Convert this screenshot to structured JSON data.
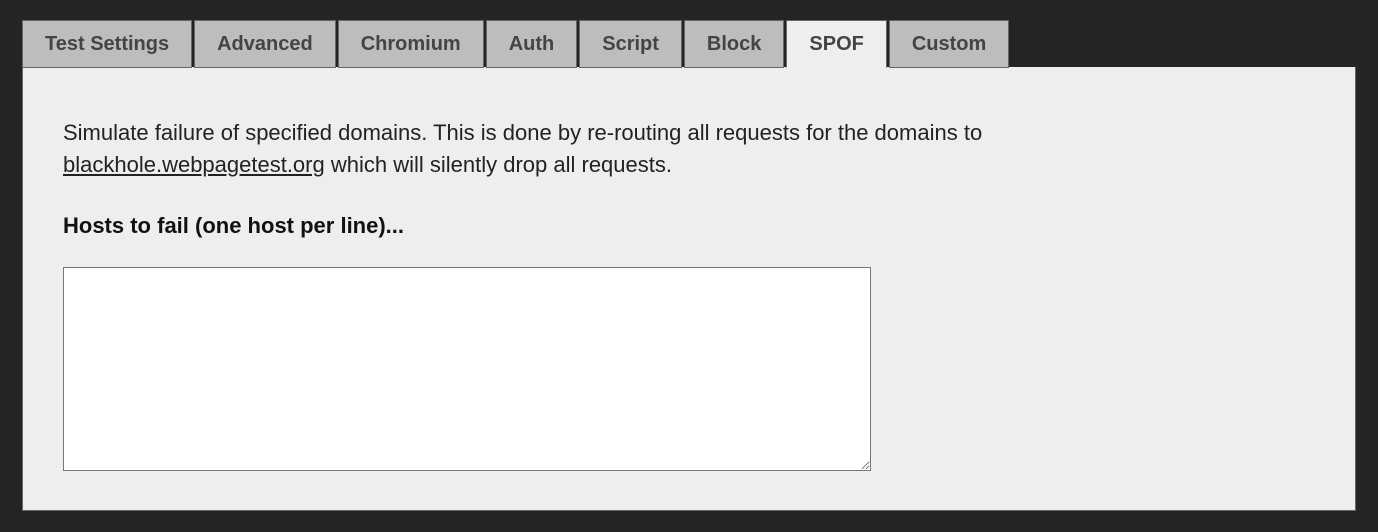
{
  "tabs": [
    {
      "label": "Test Settings",
      "key": "test-settings",
      "active": false
    },
    {
      "label": "Advanced",
      "key": "advanced",
      "active": false
    },
    {
      "label": "Chromium",
      "key": "chromium",
      "active": false
    },
    {
      "label": "Auth",
      "key": "auth",
      "active": false
    },
    {
      "label": "Script",
      "key": "script",
      "active": false
    },
    {
      "label": "Block",
      "key": "block",
      "active": false
    },
    {
      "label": "SPOF",
      "key": "spof",
      "active": true
    },
    {
      "label": "Custom",
      "key": "custom",
      "active": false
    }
  ],
  "spof": {
    "description_pre": "Simulate failure of specified domains. This is done by re-routing all requests for the domains to ",
    "link_text": "blackhole.webpagetest.org",
    "description_post": " which will silently drop all requests.",
    "field_label": "Hosts to fail (one host per line)...",
    "hosts_value": ""
  }
}
